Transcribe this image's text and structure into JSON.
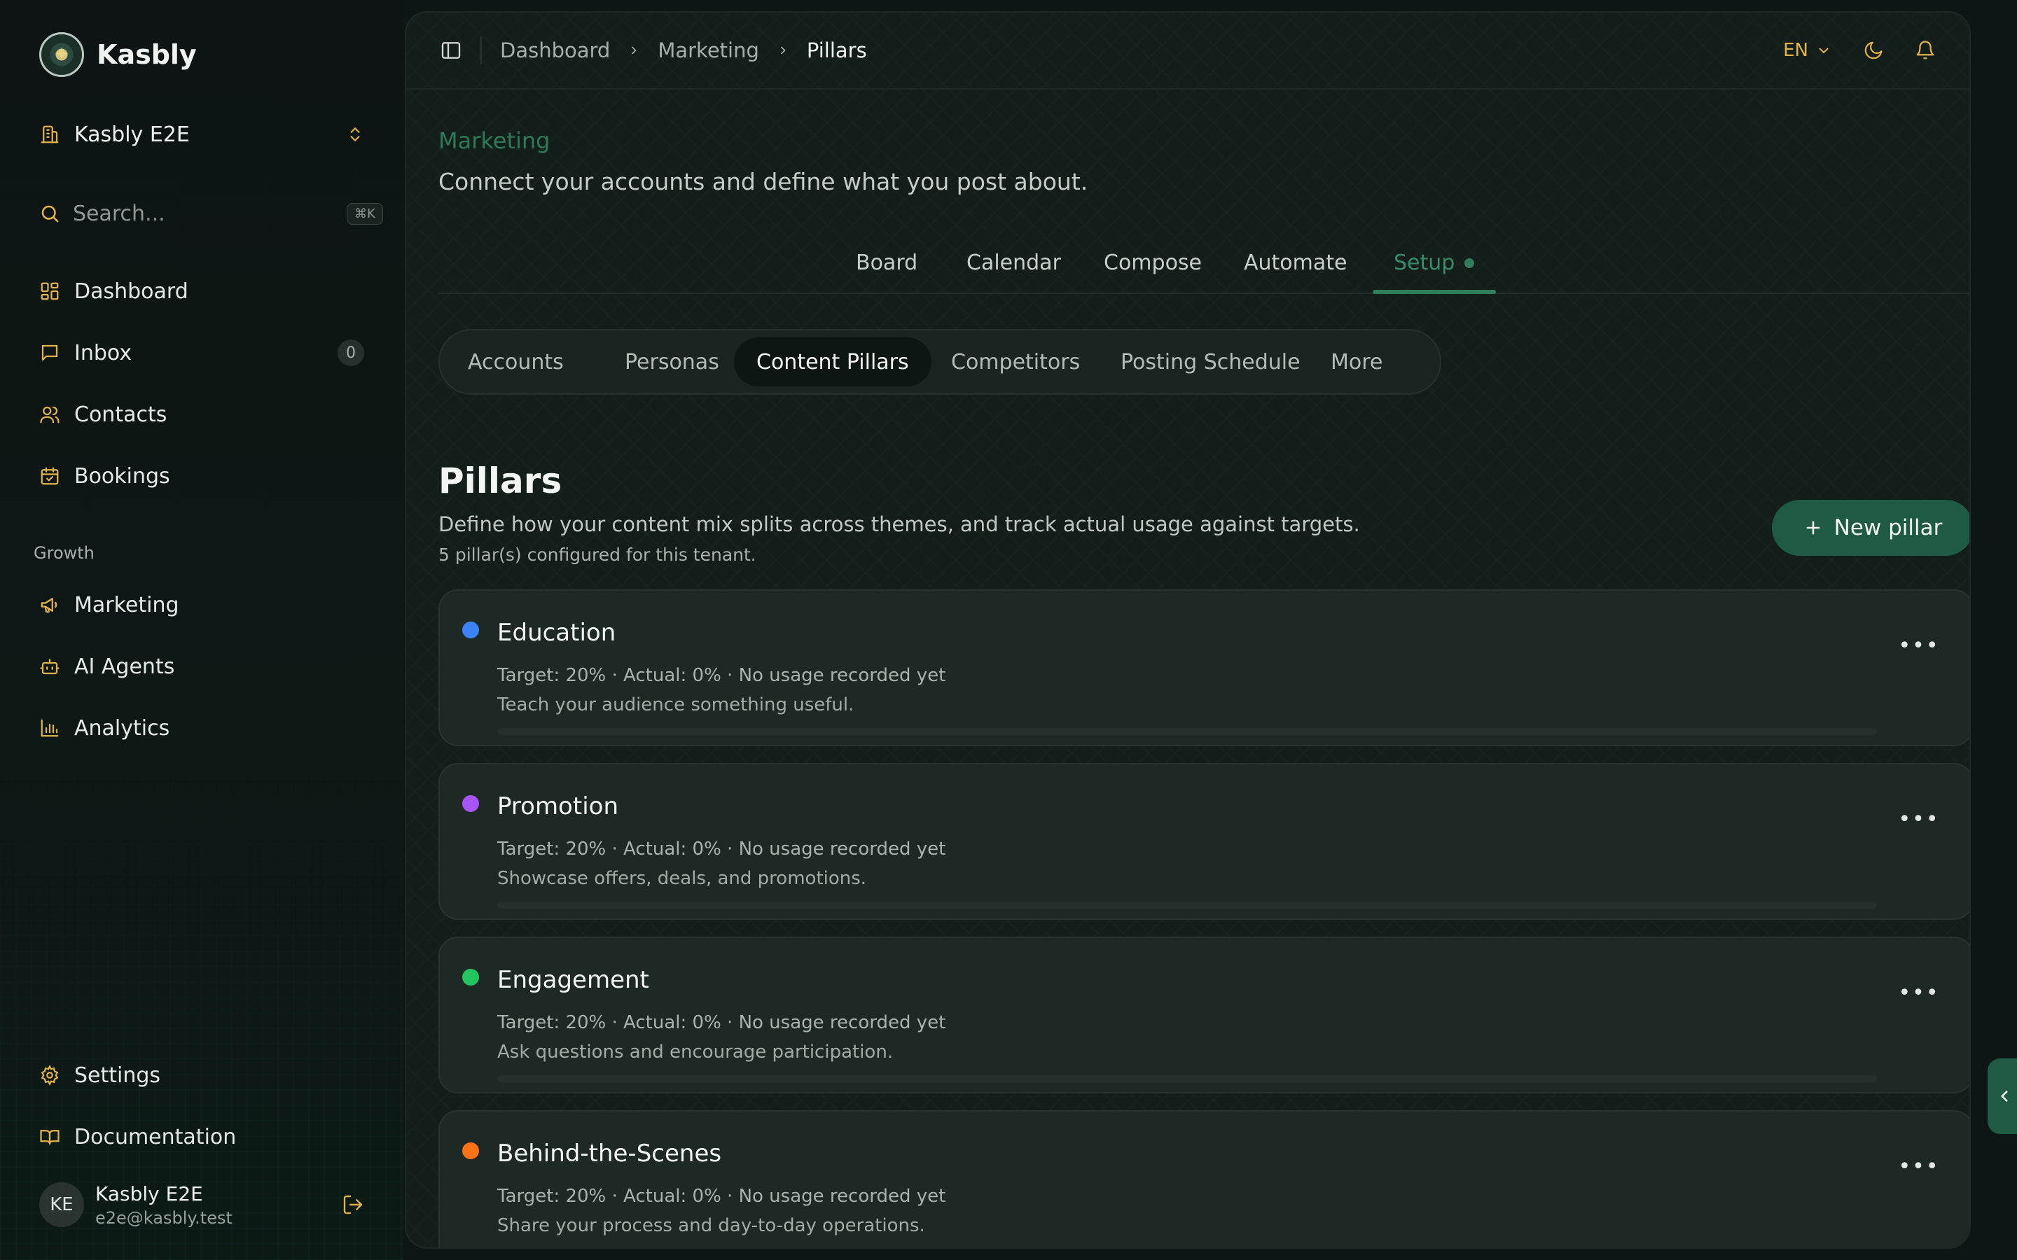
{
  "app": {
    "name": "Kasbly"
  },
  "tenant": {
    "name": "Kasbly E2E"
  },
  "search": {
    "placeholder": "Search...",
    "shortcut": "⌘K"
  },
  "nav": {
    "primary": [
      {
        "label": "Dashboard",
        "icon": "dashboard-icon"
      },
      {
        "label": "Inbox",
        "icon": "inbox-icon",
        "badge": "0"
      },
      {
        "label": "Contacts",
        "icon": "contacts-icon"
      },
      {
        "label": "Bookings",
        "icon": "calendar-check-icon"
      }
    ],
    "growth_label": "Growth",
    "growth": [
      {
        "label": "Marketing",
        "icon": "megaphone-icon"
      },
      {
        "label": "AI Agents",
        "icon": "bot-icon"
      },
      {
        "label": "Analytics",
        "icon": "bar-chart-icon"
      }
    ],
    "footer": [
      {
        "label": "Settings",
        "icon": "gear-icon"
      },
      {
        "label": "Documentation",
        "icon": "book-icon"
      }
    ]
  },
  "user": {
    "initials": "KE",
    "name": "Kasbly E2E",
    "email": "e2e@kasbly.test"
  },
  "breadcrumb": [
    "Dashboard",
    "Marketing",
    "Pillars"
  ],
  "topbar": {
    "language": "EN"
  },
  "page": {
    "kicker": "Marketing",
    "subtitle": "Connect your accounts and define what you post about."
  },
  "tabs": [
    "Board",
    "Calendar",
    "Compose",
    "Automate",
    "Setup"
  ],
  "active_tab": "Setup",
  "subtabs": [
    "Accounts",
    "Personas",
    "Content Pillars",
    "Competitors",
    "Posting Schedule",
    "More"
  ],
  "active_subtab": "Content Pillars",
  "pillars_section": {
    "title": "Pillars",
    "description": "Define how your content mix splits across themes, and track actual usage against targets.",
    "count_text": "5 pillar(s) configured for this tenant.",
    "new_button": "New pillar"
  },
  "pillars": [
    {
      "name": "Education",
      "color": "#3b82f6",
      "meta": "Target: 20% · Actual: 0% · No usage recorded yet",
      "description": "Teach your audience something useful.",
      "actual_fraction": 0
    },
    {
      "name": "Promotion",
      "color": "#a855f7",
      "meta": "Target: 20% · Actual: 0% · No usage recorded yet",
      "description": "Showcase offers, deals, and promotions.",
      "actual_fraction": 0
    },
    {
      "name": "Engagement",
      "color": "#22c55e",
      "meta": "Target: 20% · Actual: 0% · No usage recorded yet",
      "description": "Ask questions and encourage participation.",
      "actual_fraction": 0
    },
    {
      "name": "Behind-the-Scenes",
      "color": "#f97316",
      "meta": "Target: 20% · Actual: 0% · No usage recorded yet",
      "description": "Share your process and day-to-day operations.",
      "actual_fraction": 0
    }
  ],
  "colors": {
    "accent": "#2f7d5b",
    "button": "#1f5a45",
    "icon_gold": "#e3b24a"
  }
}
